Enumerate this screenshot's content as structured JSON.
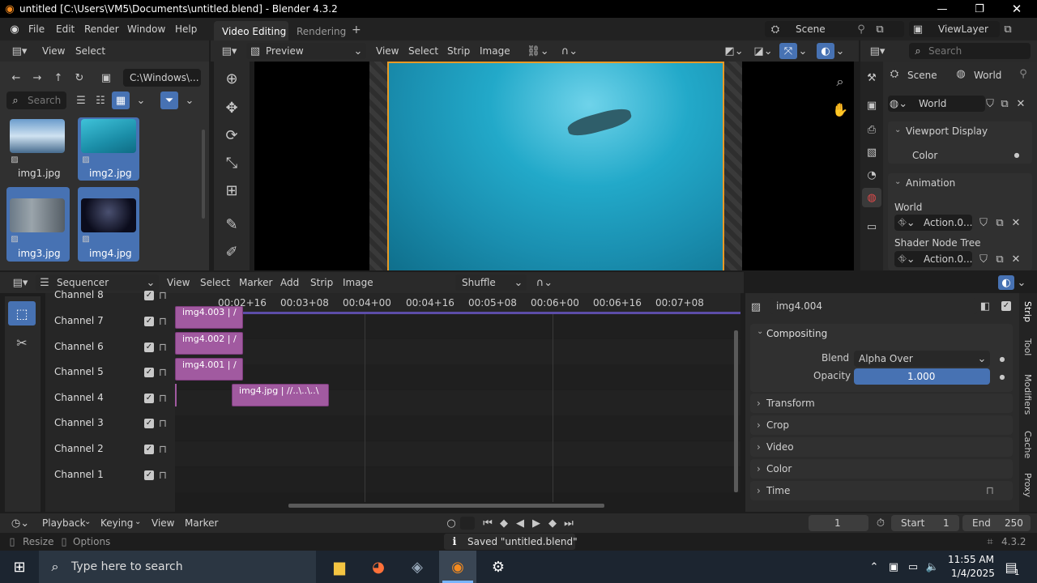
{
  "window": {
    "title": "untitled [C:\\Users\\VM5\\Documents\\untitled.blend] - Blender 4.3.2"
  },
  "menu": {
    "file": "File",
    "edit": "Edit",
    "render": "Render",
    "window": "Window",
    "help": "Help"
  },
  "workspaces": {
    "active": "Video Editing",
    "other": "Rendering",
    "add": "+"
  },
  "scene": {
    "label": "Scene",
    "viewlayer": "ViewLayer"
  },
  "filebrowser": {
    "view": "View",
    "select": "Select",
    "path": "C:\\Windows\\...",
    "search_placeholder": "Search",
    "files": [
      {
        "name": "img1.jpg"
      },
      {
        "name": "img2.jpg"
      },
      {
        "name": "img3.jpg"
      },
      {
        "name": "img4.jpg"
      }
    ]
  },
  "preview": {
    "mode": "Preview",
    "menus": [
      "View",
      "Select",
      "Strip",
      "Image"
    ]
  },
  "properties": {
    "search_placeholder": "Search",
    "breadcrumb_scene": "Scene",
    "breadcrumb_world": "World",
    "world_name": "World",
    "viewport_display": "Viewport Display",
    "color_label": "Color",
    "animation": "Animation",
    "world_label": "World",
    "action1": "Action.0...",
    "shader_tree": "Shader Node Tree",
    "action2": "Action.0..."
  },
  "sequencer": {
    "mode": "Sequencer",
    "menus": [
      "View",
      "Select",
      "Marker",
      "Add",
      "Strip",
      "Image"
    ],
    "shuffle": "Shuffle",
    "times": [
      "00:02+16",
      "00:03+08",
      "00:04+00",
      "00:04+16",
      "00:05+08",
      "00:06+00",
      "00:06+16",
      "00:07+08"
    ],
    "channels": [
      "Channel 8",
      "Channel 7",
      "Channel 6",
      "Channel 5",
      "Channel 4",
      "Channel 3",
      "Channel 2",
      "Channel 1"
    ],
    "strips": [
      "img4.003 | /",
      "img4.002 | /",
      "img4.001 | /",
      "img4.jpg | //..\\..\\..\\"
    ]
  },
  "strip_props": {
    "name": "img4.004",
    "compositing": "Compositing",
    "blend_label": "Blend",
    "blend_value": "Alpha Over",
    "opacity_label": "Opacity",
    "opacity_value": "1.000",
    "sections": [
      "Transform",
      "Crop",
      "Video",
      "Color",
      "Time"
    ],
    "tabs": [
      "Strip",
      "Tool",
      "Modifiers",
      "Cache",
      "Proxy"
    ]
  },
  "timeline": {
    "playback": "Playback",
    "keying": "Keying",
    "view": "View",
    "marker": "Marker",
    "frame": "1",
    "start_label": "Start",
    "start": "1",
    "end_label": "End",
    "end": "250"
  },
  "status": {
    "resize": "Resize",
    "options": "Options",
    "saved": "Saved \"untitled.blend\"",
    "version": "4.3.2"
  },
  "taskbar": {
    "search_placeholder": "Type here to search",
    "time": "11:55 AM",
    "date": "1/4/2025",
    "notifications": "1"
  },
  "colors": {
    "accent": "#4772b3",
    "strip": "#a15aa0",
    "selected_outline": "#e89a26"
  }
}
